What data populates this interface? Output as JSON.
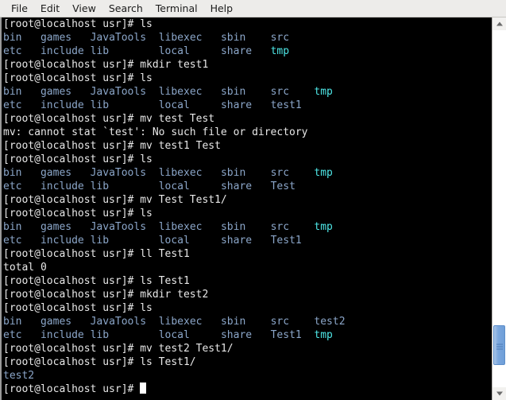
{
  "window": {
    "title": "Terminal"
  },
  "menu": {
    "items": [
      {
        "label": "File",
        "name": "menu-file"
      },
      {
        "label": "Edit",
        "name": "menu-edit"
      },
      {
        "label": "View",
        "name": "menu-view"
      },
      {
        "label": "Search",
        "name": "menu-search"
      },
      {
        "label": "Terminal",
        "name": "menu-terminal"
      },
      {
        "label": "Help",
        "name": "menu-help"
      }
    ]
  },
  "colors": {
    "background": "#000000",
    "foreground": "#e8e8e8",
    "directory_blue": "#8ba6c9",
    "symlink_cyan": "#4ee7e7",
    "menubar_background": "#edecea",
    "scrollbar_thumb": "#7ba7dd"
  },
  "terminal": {
    "prompt": "[root@localhost usr]# ",
    "cursor_visible": true,
    "lines": [
      {
        "type": "command",
        "prompt": "[root@localhost usr]# ",
        "command": "ls"
      },
      {
        "type": "cols",
        "cells": [
          {
            "t": "bin",
            "c": "blue"
          },
          {
            "t": "games",
            "c": "blue"
          },
          {
            "t": "JavaTools",
            "c": "blue"
          },
          {
            "t": "libexec",
            "c": "blue"
          },
          {
            "t": "sbin",
            "c": "blue"
          },
          {
            "t": "src",
            "c": "blue"
          }
        ]
      },
      {
        "type": "cols",
        "cells": [
          {
            "t": "etc",
            "c": "blue"
          },
          {
            "t": "include",
            "c": "blue"
          },
          {
            "t": "lib",
            "c": "blue"
          },
          {
            "t": "local",
            "c": "blue"
          },
          {
            "t": "share",
            "c": "blue"
          },
          {
            "t": "tmp",
            "c": "cyan"
          }
        ]
      },
      {
        "type": "command",
        "prompt": "[root@localhost usr]# ",
        "command": "mkdir test1"
      },
      {
        "type": "command",
        "prompt": "[root@localhost usr]# ",
        "command": "ls"
      },
      {
        "type": "cols",
        "cells": [
          {
            "t": "bin",
            "c": "blue"
          },
          {
            "t": "games",
            "c": "blue"
          },
          {
            "t": "JavaTools",
            "c": "blue"
          },
          {
            "t": "libexec",
            "c": "blue"
          },
          {
            "t": "sbin",
            "c": "blue"
          },
          {
            "t": "src",
            "c": "blue"
          },
          {
            "t": "tmp",
            "c": "cyan"
          }
        ]
      },
      {
        "type": "cols",
        "cells": [
          {
            "t": "etc",
            "c": "blue"
          },
          {
            "t": "include",
            "c": "blue"
          },
          {
            "t": "lib",
            "c": "blue"
          },
          {
            "t": "local",
            "c": "blue"
          },
          {
            "t": "share",
            "c": "blue"
          },
          {
            "t": "test1",
            "c": "blue"
          }
        ]
      },
      {
        "type": "command",
        "prompt": "[root@localhost usr]# ",
        "command": "mv test Test"
      },
      {
        "type": "output",
        "text": "mv: cannot stat `test': No such file or directory"
      },
      {
        "type": "command",
        "prompt": "[root@localhost usr]# ",
        "command": "mv test1 Test"
      },
      {
        "type": "command",
        "prompt": "[root@localhost usr]# ",
        "command": "ls"
      },
      {
        "type": "cols",
        "cells": [
          {
            "t": "bin",
            "c": "blue"
          },
          {
            "t": "games",
            "c": "blue"
          },
          {
            "t": "JavaTools",
            "c": "blue"
          },
          {
            "t": "libexec",
            "c": "blue"
          },
          {
            "t": "sbin",
            "c": "blue"
          },
          {
            "t": "src",
            "c": "blue"
          },
          {
            "t": "tmp",
            "c": "cyan"
          }
        ]
      },
      {
        "type": "cols",
        "cells": [
          {
            "t": "etc",
            "c": "blue"
          },
          {
            "t": "include",
            "c": "blue"
          },
          {
            "t": "lib",
            "c": "blue"
          },
          {
            "t": "local",
            "c": "blue"
          },
          {
            "t": "share",
            "c": "blue"
          },
          {
            "t": "Test",
            "c": "blue"
          }
        ]
      },
      {
        "type": "command",
        "prompt": "[root@localhost usr]# ",
        "command": "mv Test Test1/"
      },
      {
        "type": "command",
        "prompt": "[root@localhost usr]# ",
        "command": "ls"
      },
      {
        "type": "cols",
        "cells": [
          {
            "t": "bin",
            "c": "blue"
          },
          {
            "t": "games",
            "c": "blue"
          },
          {
            "t": "JavaTools",
            "c": "blue"
          },
          {
            "t": "libexec",
            "c": "blue"
          },
          {
            "t": "sbin",
            "c": "blue"
          },
          {
            "t": "src",
            "c": "blue"
          },
          {
            "t": "tmp",
            "c": "cyan"
          }
        ]
      },
      {
        "type": "cols",
        "cells": [
          {
            "t": "etc",
            "c": "blue"
          },
          {
            "t": "include",
            "c": "blue"
          },
          {
            "t": "lib",
            "c": "blue"
          },
          {
            "t": "local",
            "c": "blue"
          },
          {
            "t": "share",
            "c": "blue"
          },
          {
            "t": "Test1",
            "c": "blue"
          }
        ]
      },
      {
        "type": "command",
        "prompt": "[root@localhost usr]# ",
        "command": "ll Test1"
      },
      {
        "type": "output",
        "text": "total 0"
      },
      {
        "type": "command",
        "prompt": "[root@localhost usr]# ",
        "command": "ls Test1"
      },
      {
        "type": "command",
        "prompt": "[root@localhost usr]# ",
        "command": "mkdir test2"
      },
      {
        "type": "command",
        "prompt": "[root@localhost usr]# ",
        "command": "ls"
      },
      {
        "type": "cols",
        "cells": [
          {
            "t": "bin",
            "c": "blue"
          },
          {
            "t": "games",
            "c": "blue"
          },
          {
            "t": "JavaTools",
            "c": "blue"
          },
          {
            "t": "libexec",
            "c": "blue"
          },
          {
            "t": "sbin",
            "c": "blue"
          },
          {
            "t": "src",
            "c": "blue"
          },
          {
            "t": "test2",
            "c": "blue"
          }
        ]
      },
      {
        "type": "cols",
        "cells": [
          {
            "t": "etc",
            "c": "blue"
          },
          {
            "t": "include",
            "c": "blue"
          },
          {
            "t": "lib",
            "c": "blue"
          },
          {
            "t": "local",
            "c": "blue"
          },
          {
            "t": "share",
            "c": "blue"
          },
          {
            "t": "Test1",
            "c": "blue"
          },
          {
            "t": "tmp",
            "c": "cyan"
          }
        ]
      },
      {
        "type": "command",
        "prompt": "[root@localhost usr]# ",
        "command": "mv test2 Test1/"
      },
      {
        "type": "command",
        "prompt": "[root@localhost usr]# ",
        "command": "ls Test1/"
      },
      {
        "type": "cols",
        "cells": [
          {
            "t": "test2",
            "c": "blue"
          }
        ]
      },
      {
        "type": "prompt_cursor",
        "prompt": "[root@localhost usr]# "
      }
    ],
    "column_stops": [
      0,
      6,
      14,
      25,
      35,
      43,
      50,
      58
    ],
    "column_stops_8": [
      0,
      6,
      14,
      25,
      35,
      43,
      50,
      57
    ]
  },
  "scrollbar": {
    "up_arrow": "scroll-up",
    "down_arrow": "scroll-down",
    "thumb_position_percent": 93
  }
}
